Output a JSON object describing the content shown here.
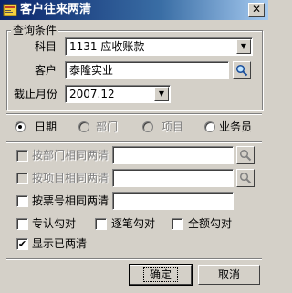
{
  "window": {
    "title": "客户往来两清",
    "close_glyph": "✕"
  },
  "query": {
    "group_label": "查询条件",
    "subject": {
      "label": "科目",
      "value": "1131 应收账款"
    },
    "customer": {
      "label": "客户",
      "value": "泰隆实业"
    },
    "cutoff": {
      "label": "截止月份",
      "value": "2007.12"
    }
  },
  "mode_radios": [
    {
      "label": "日期",
      "checked": true,
      "enabled": true
    },
    {
      "label": "部门",
      "checked": false,
      "enabled": false
    },
    {
      "label": "项目",
      "checked": false,
      "enabled": false
    },
    {
      "label": "业务员",
      "checked": false,
      "enabled": true
    }
  ],
  "clear_options": {
    "by_department": {
      "label": "按部门相同两清",
      "checked": false,
      "enabled": false,
      "value": ""
    },
    "by_project": {
      "label": "按项目相同两清",
      "checked": false,
      "enabled": false,
      "value": ""
    },
    "by_ticket": {
      "label": "按票号相同两清",
      "checked": false,
      "enabled": true,
      "value": ""
    }
  },
  "match_options": [
    {
      "label": "专认勾对",
      "checked": false
    },
    {
      "label": "逐笔勾对",
      "checked": false
    },
    {
      "label": "全额勾对",
      "checked": false
    }
  ],
  "show_cleared": {
    "label": "显示已两清",
    "checked": true,
    "mark": "✔"
  },
  "buttons": {
    "ok": "确定",
    "cancel": "取消"
  },
  "icons": {
    "dropdown_glyph": "▼"
  }
}
